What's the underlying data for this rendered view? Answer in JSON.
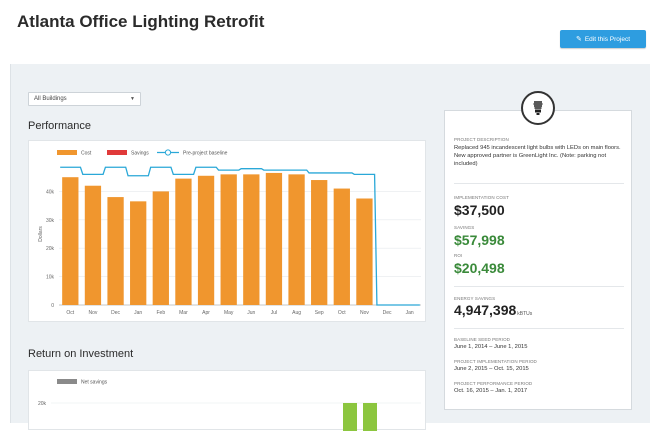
{
  "header": {
    "title": "Atlanta Office Lighting Retrofit",
    "edit_button": "Edit this Project",
    "edit_icon": "edit-icon"
  },
  "filter": {
    "selected": "All Buildings"
  },
  "performance": {
    "title": "Performance"
  },
  "roi": {
    "title": "Return on Investment",
    "legend": "Net savings",
    "y_tick": "20k"
  },
  "side": {
    "icon": "lightbulb-icon",
    "description_label": "PROJECT DESCRIPTION",
    "description": "Replaced 945 incandescent light bulbs with LEDs on main floors. New approved partner is GreenLight Inc. (Note: parking not included)",
    "cost_label": "IMPLEMENTATION COST",
    "cost": "$37,500",
    "savings_label": "SAVINGS",
    "savings": "$57,998",
    "roi_label": "ROI",
    "roi": "$20,498",
    "energy_label": "ENERGY SAVINGS",
    "energy": "4,947,398",
    "energy_unit": "kBTUs",
    "baseline_label": "BASELINE SEED PERIOD",
    "baseline": "June 1, 2014 – June 1, 2015",
    "impl_label": "PROJECT IMPLEMENTATION PERIOD",
    "impl": "June 2, 2015 – Oct. 15, 2015",
    "perf_label": "PROJECT PERFORMANCE PERIOD",
    "perf": "Oct. 16, 2015 – Jan. 1, 2017"
  },
  "colors": {
    "cost": "#f0962e",
    "savings": "#e03a3a",
    "baseline": "#2aa8d8",
    "net_savings": "#8cc63f",
    "button": "#2e9de0"
  },
  "chart_data": [
    {
      "type": "bar",
      "legend": [
        "Cost",
        "Savings",
        "Pre-project baseline"
      ],
      "ylabel": "Dollars",
      "ylim": [
        0,
        50000
      ],
      "y_ticks": [
        "0",
        "10k",
        "20k",
        "30k",
        "40k"
      ],
      "categories": [
        "Oct",
        "Nov",
        "Dec",
        "Jan",
        "Feb",
        "Mar",
        "Apr",
        "May",
        "Jun",
        "Jul",
        "Aug",
        "Sep",
        "Oct",
        "Nov",
        "Dec",
        "Jan"
      ],
      "series": [
        {
          "name": "Cost",
          "type": "bar",
          "values": [
            45000,
            42000,
            38000,
            36500,
            40000,
            44500,
            45500,
            46000,
            46000,
            46500,
            46000,
            44000,
            41000,
            37500,
            null,
            null
          ]
        },
        {
          "name": "Pre-project baseline",
          "type": "step-line",
          "values": [
            48500,
            46000,
            48500,
            45500,
            48500,
            46000,
            48500,
            47500,
            48000,
            47500,
            47500,
            46500,
            46500,
            46000,
            0,
            0
          ]
        }
      ]
    },
    {
      "type": "bar",
      "legend": [
        "Net savings"
      ],
      "y_ticks": [
        "20k"
      ],
      "series": [
        {
          "name": "Net savings",
          "values": [
            20000,
            20000
          ]
        }
      ]
    }
  ]
}
